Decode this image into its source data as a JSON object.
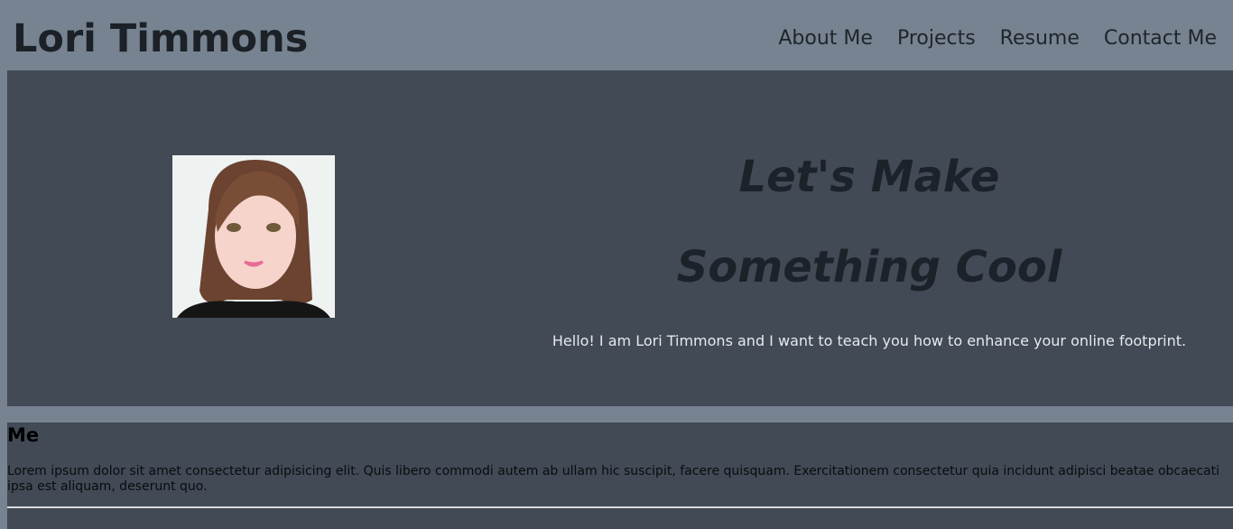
{
  "header": {
    "title": "Lori Timmons",
    "nav": [
      "About Me",
      "Projects",
      "Resume",
      "Contact Me"
    ]
  },
  "hero": {
    "headline_1": "Let's Make",
    "headline_2": "Something Cool",
    "tagline": "Hello! I am Lori Timmons and I want to teach you how to enhance your online footprint."
  },
  "about": {
    "heading": "Me",
    "body": "Lorem ipsum dolor sit amet consectetur adipisicing elit. Quis libero commodi autem ab ullam hic suscipit, facere quisquam. Exercitationem consectetur quia incidunt adipisci beatae obcaecati ipsa est aliquam, deserunt quo."
  }
}
